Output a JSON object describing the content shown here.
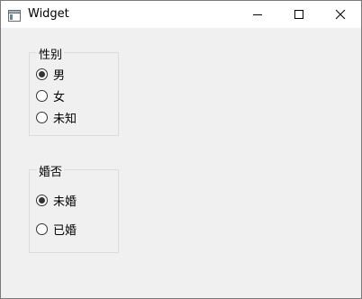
{
  "window": {
    "title": "Widget"
  },
  "gender_group": {
    "label": "性别",
    "options": [
      {
        "label": "男",
        "checked": true
      },
      {
        "label": "女",
        "checked": false
      },
      {
        "label": "未知",
        "checked": false
      }
    ]
  },
  "marital_group": {
    "label": "婚否",
    "options": [
      {
        "label": "未婚",
        "checked": true
      },
      {
        "label": "已婚",
        "checked": false
      }
    ]
  },
  "icons": [
    "app-icon",
    "minimize-icon",
    "maximize-icon",
    "close-icon"
  ]
}
